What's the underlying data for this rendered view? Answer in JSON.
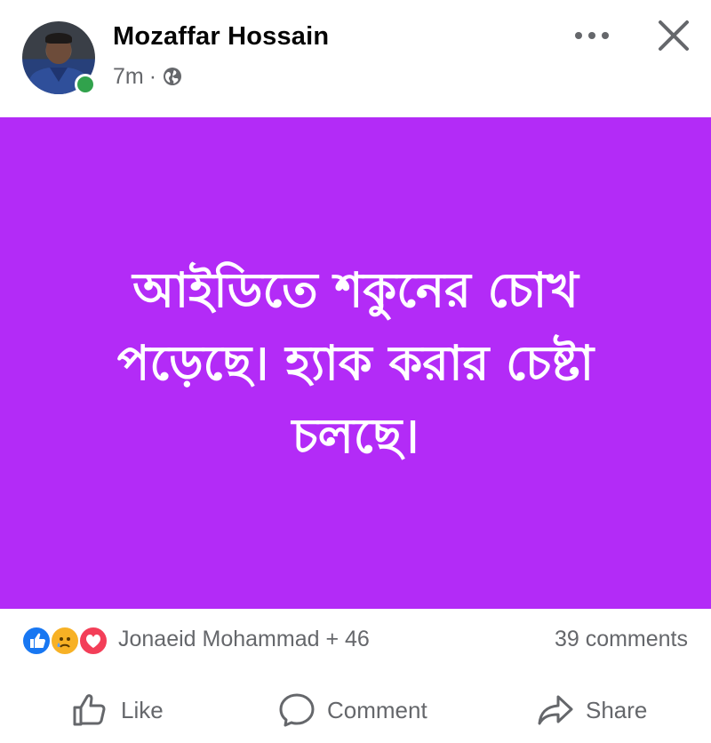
{
  "post": {
    "author": "Mozaffar Hossain",
    "time": "7m",
    "separator": "·",
    "privacy_icon": "globe-icon",
    "text": "আইডিতে শকুনের চোখ পড়েছে। হ্যাক করার চেষ্টা চলছে।",
    "background_color": "#b32bf7"
  },
  "reactions": {
    "icons": [
      "like-icon",
      "sad-icon",
      "love-icon"
    ],
    "summary": "Jonaeid Mohammad + 46",
    "comments": "39 comments"
  },
  "actions": {
    "like_label": "Like",
    "comment_label": "Comment",
    "share_label": "Share"
  }
}
